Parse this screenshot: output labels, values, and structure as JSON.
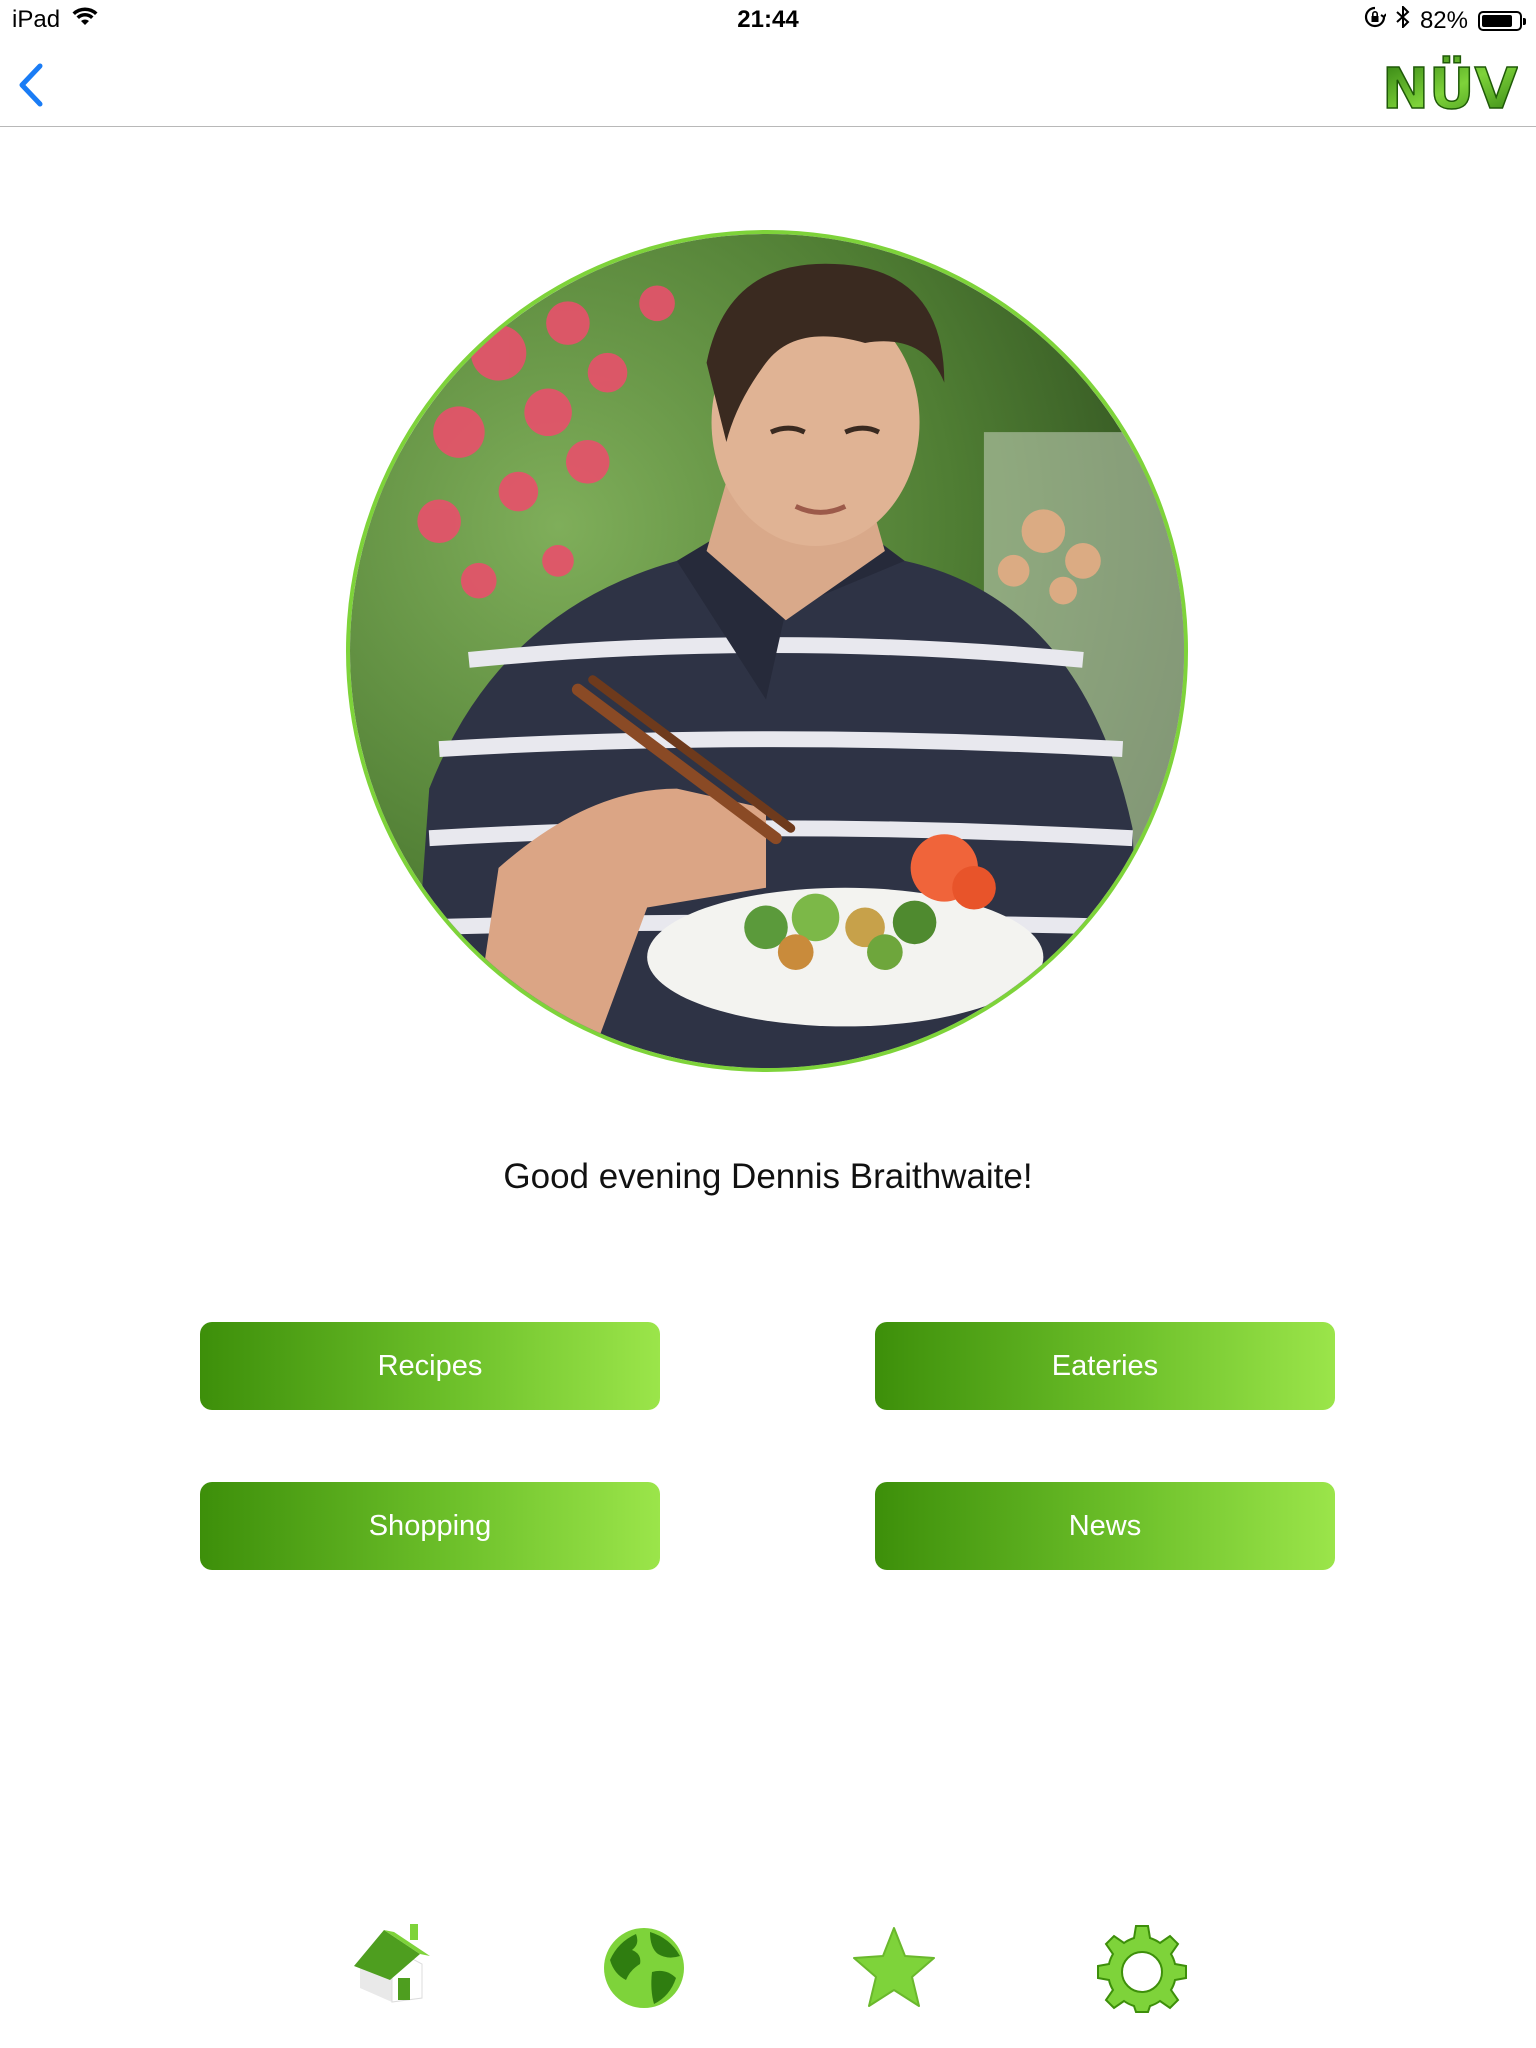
{
  "status_bar": {
    "device": "iPad",
    "time": "21:44",
    "battery_percent": "82%",
    "battery_level": 0.82,
    "icons": [
      "wifi-icon",
      "rotation-lock-icon",
      "bluetooth-icon",
      "battery-icon"
    ]
  },
  "nav": {
    "back_icon": "chevron-left-icon",
    "logo_text": "NÜV"
  },
  "profile": {
    "greeting": "Good evening Dennis Braithwaite!",
    "avatar": "photo of a man eating salad with chopsticks"
  },
  "menu": {
    "recipes": "Recipes",
    "eateries": "Eateries",
    "shopping": "Shopping",
    "news": "News"
  },
  "tab_bar": {
    "items": [
      "home-icon",
      "globe-icon",
      "star-icon",
      "gear-icon"
    ]
  },
  "colors": {
    "accent_green": "#7ed33a",
    "button_dark": "#3d8f0a",
    "button_light": "#9be54a",
    "ios_blue": "#1a7cf5"
  }
}
